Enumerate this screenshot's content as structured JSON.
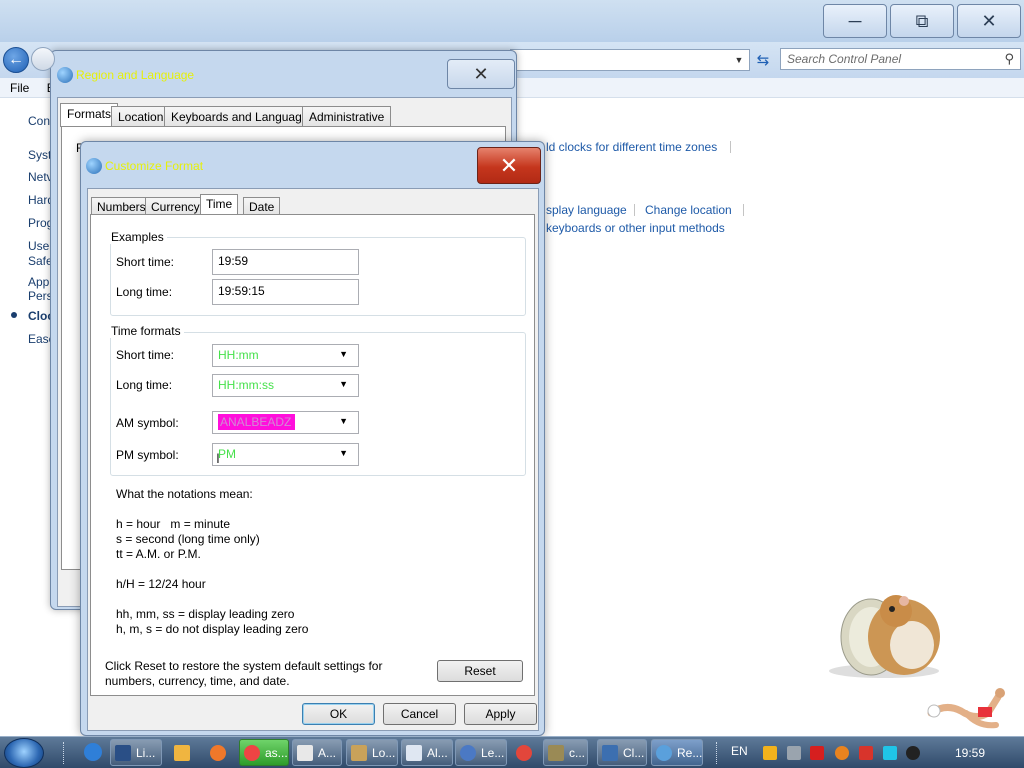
{
  "control_panel": {
    "search_placeholder": "Search Control Panel",
    "menu": [
      "File",
      "E"
    ],
    "left_nav": [
      "Con",
      "Syst",
      "Netv",
      "Hard",
      "Prog",
      "User",
      "Safe",
      "App",
      "Pers",
      "Cloc",
      "Ease"
    ],
    "links": {
      "add_clocks": "ld clocks for different time zones",
      "display_language": "splay language",
      "change_location": "Change location",
      "keyboards": "keyboards or other input methods"
    }
  },
  "region_dialog": {
    "title": "Region and Language",
    "tabs": [
      "Formats",
      "Location",
      "Keyboards and Languages",
      "Administrative"
    ],
    "fragment_F": "F"
  },
  "customize_dialog": {
    "title": "Customize Format",
    "tabs": [
      "Numbers",
      "Currency",
      "Time",
      "Date"
    ],
    "examples": {
      "label": "Examples",
      "short_time_label": "Short time:",
      "short_time_value": "19:59",
      "long_time_label": "Long time:",
      "long_time_value": "19:59:15"
    },
    "time_formats": {
      "label": "Time formats",
      "short_time_label": "Short time:",
      "short_time_value": "HH:mm",
      "long_time_label": "Long time:",
      "long_time_value": "HH:mm:ss",
      "am_label": "AM symbol:",
      "am_value": "ANALBEADZ",
      "pm_label": "PM symbol:",
      "pm_value": "PM"
    },
    "notes": "What the notations mean:\n\nh = hour   m = minute\ns = second (long time only)\ntt = A.M. or P.M.\n\nh/H = 12/24 hour\n\nhh, mm, ss = display leading zero\nh, m, s = do not display leading zero",
    "reset_text": "Click Reset to restore the system default settings for\nnumbers, currency, time, and date.",
    "reset_label": "Reset",
    "ok_label": "OK",
    "cancel_label": "Cancel",
    "apply_label": "Apply"
  },
  "taskbar": {
    "items": [
      "Li...",
      "as...",
      "A...",
      "Lo...",
      "Al...",
      "Le...",
      "c...",
      "Cl...",
      "Re..."
    ],
    "language": "EN",
    "clock": "19:59"
  },
  "colors": {
    "dialog_title_text": "#e6f00a",
    "combo_value_text": "#46e14b",
    "am_highlight": "#ff0fdc",
    "close_red": "#c5361d",
    "link_blue": "#1e5aa8"
  }
}
